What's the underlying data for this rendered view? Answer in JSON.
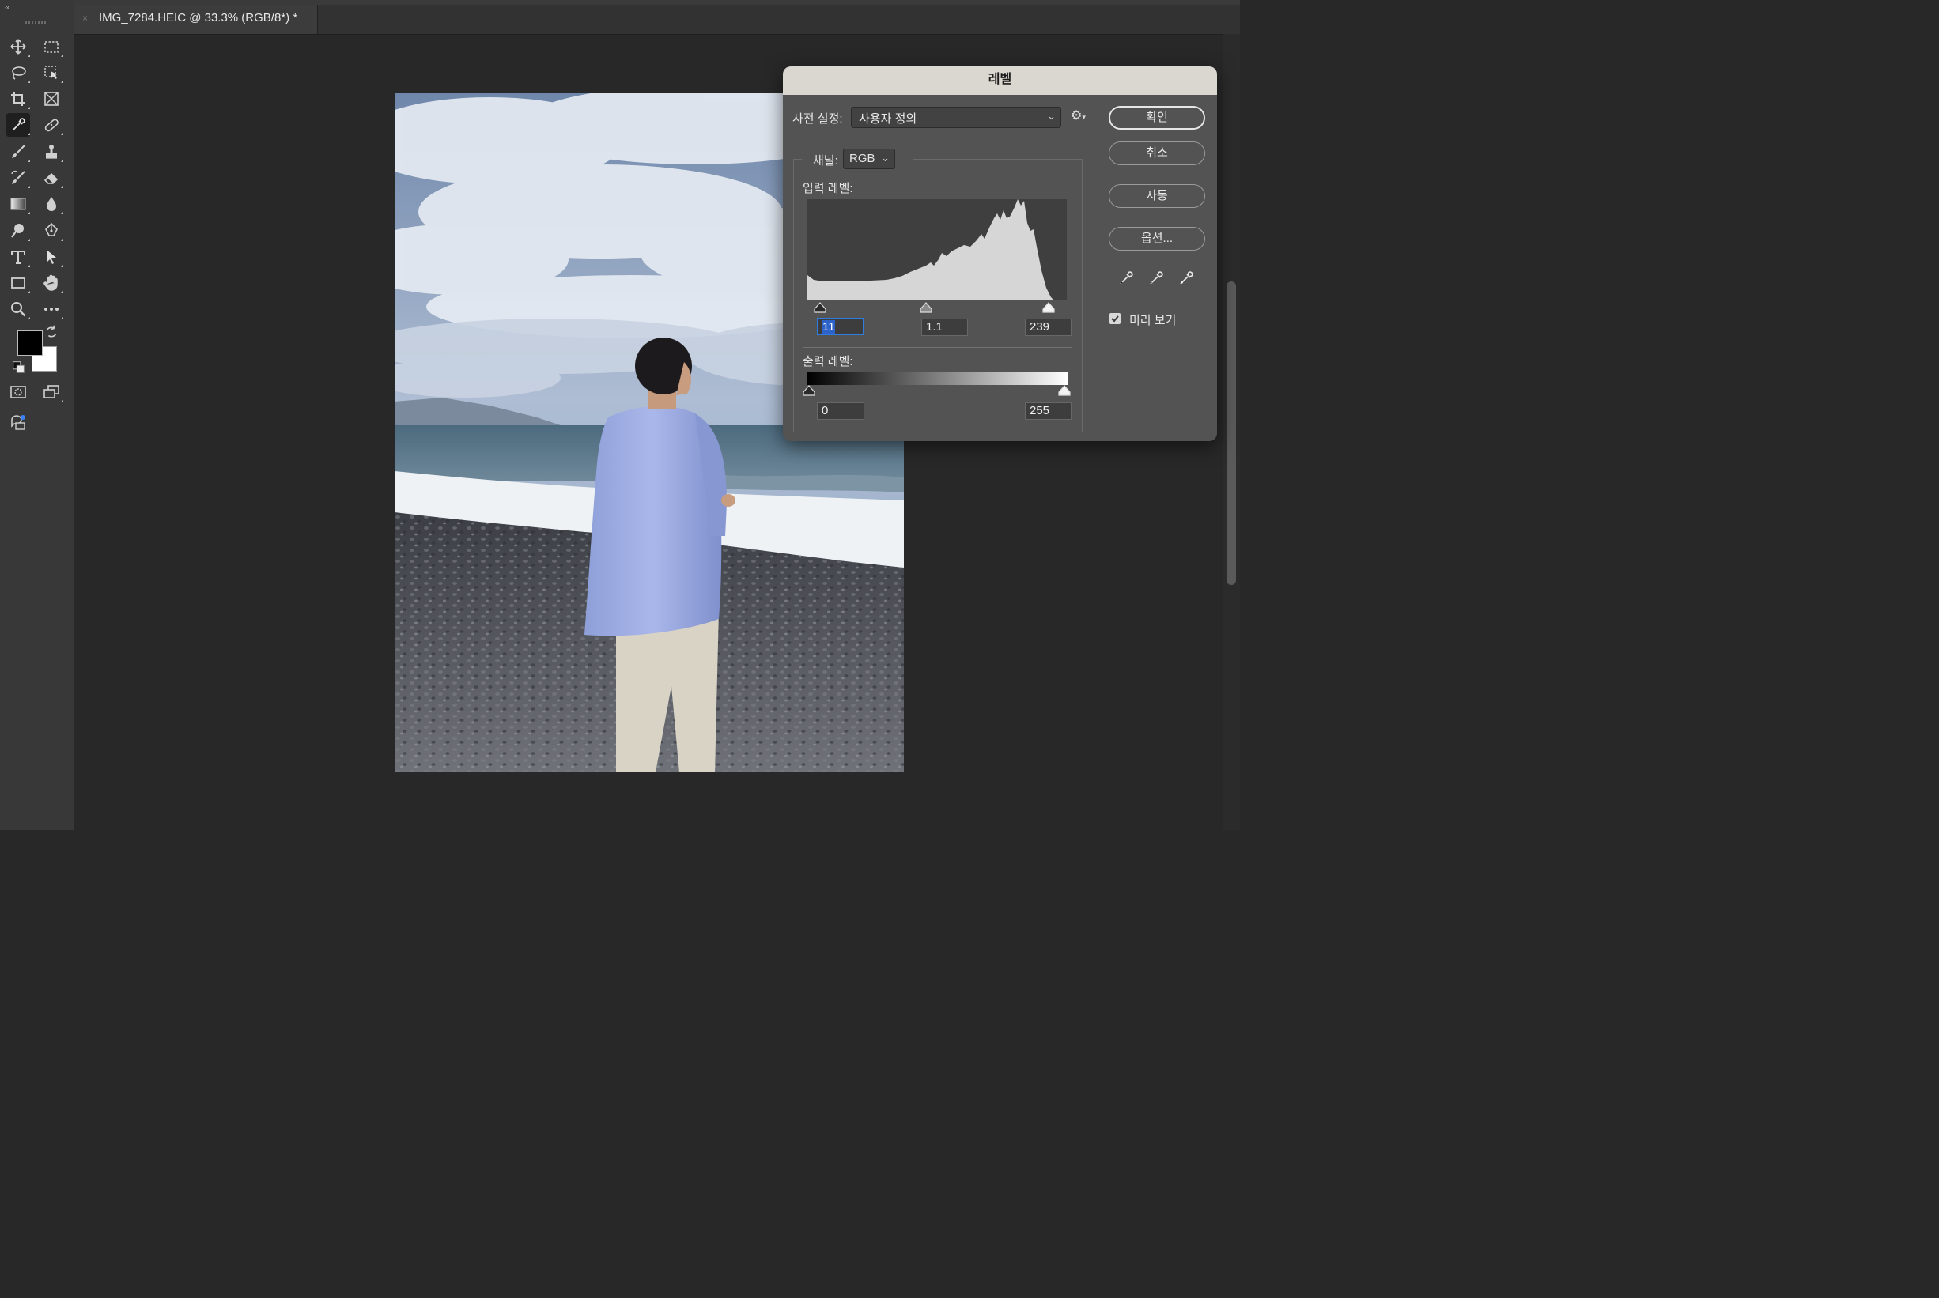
{
  "document_tab": {
    "title": "IMG_7284.HEIC @ 33.3% (RGB/8*) *",
    "close_glyph": "×"
  },
  "toolbar": {
    "collapse_glyph": "‹‹",
    "tools": [
      "move-icon",
      "marquee-icon",
      "lasso-icon",
      "object-select-icon",
      "crop-icon",
      "frame-icon",
      "eyedropper-icon",
      "healing-brush-icon",
      "brush-icon",
      "clone-stamp-icon",
      "history-brush-icon",
      "eraser-icon",
      "gradient-icon",
      "blur-icon",
      "dodge-icon",
      "pen-icon",
      "type-icon",
      "path-select-icon",
      "rectangle-icon",
      "hand-icon",
      "zoom-icon",
      "more-tools-icon",
      "quick-mask-icon",
      "screen-mode-icon",
      "generative-icon"
    ],
    "foreground_color": "#000000",
    "background_color": "#ffffff"
  },
  "levels_dialog": {
    "title": "레벨",
    "preset_label": "사전 설정:",
    "preset_value": "사용자 정의",
    "channel_label": "채널:",
    "channel_value": "RGB",
    "input_levels_label": "입력 레벨:",
    "input_black": "11",
    "input_gamma": "1.1",
    "input_white": "239",
    "output_levels_label": "출력 레벨:",
    "output_black": "0",
    "output_white": "255",
    "buttons": {
      "ok": "확인",
      "cancel": "취소",
      "auto": "자동",
      "options": "옵션..."
    },
    "preview_label": "미리 보기",
    "preview_checked": true
  },
  "colors": {
    "app_bg": "#282828",
    "panel_bg": "#383838",
    "dialog_bg": "#535353",
    "dialog_title_bg": "#dad6d0",
    "focus_blue": "#2d7ce0"
  }
}
